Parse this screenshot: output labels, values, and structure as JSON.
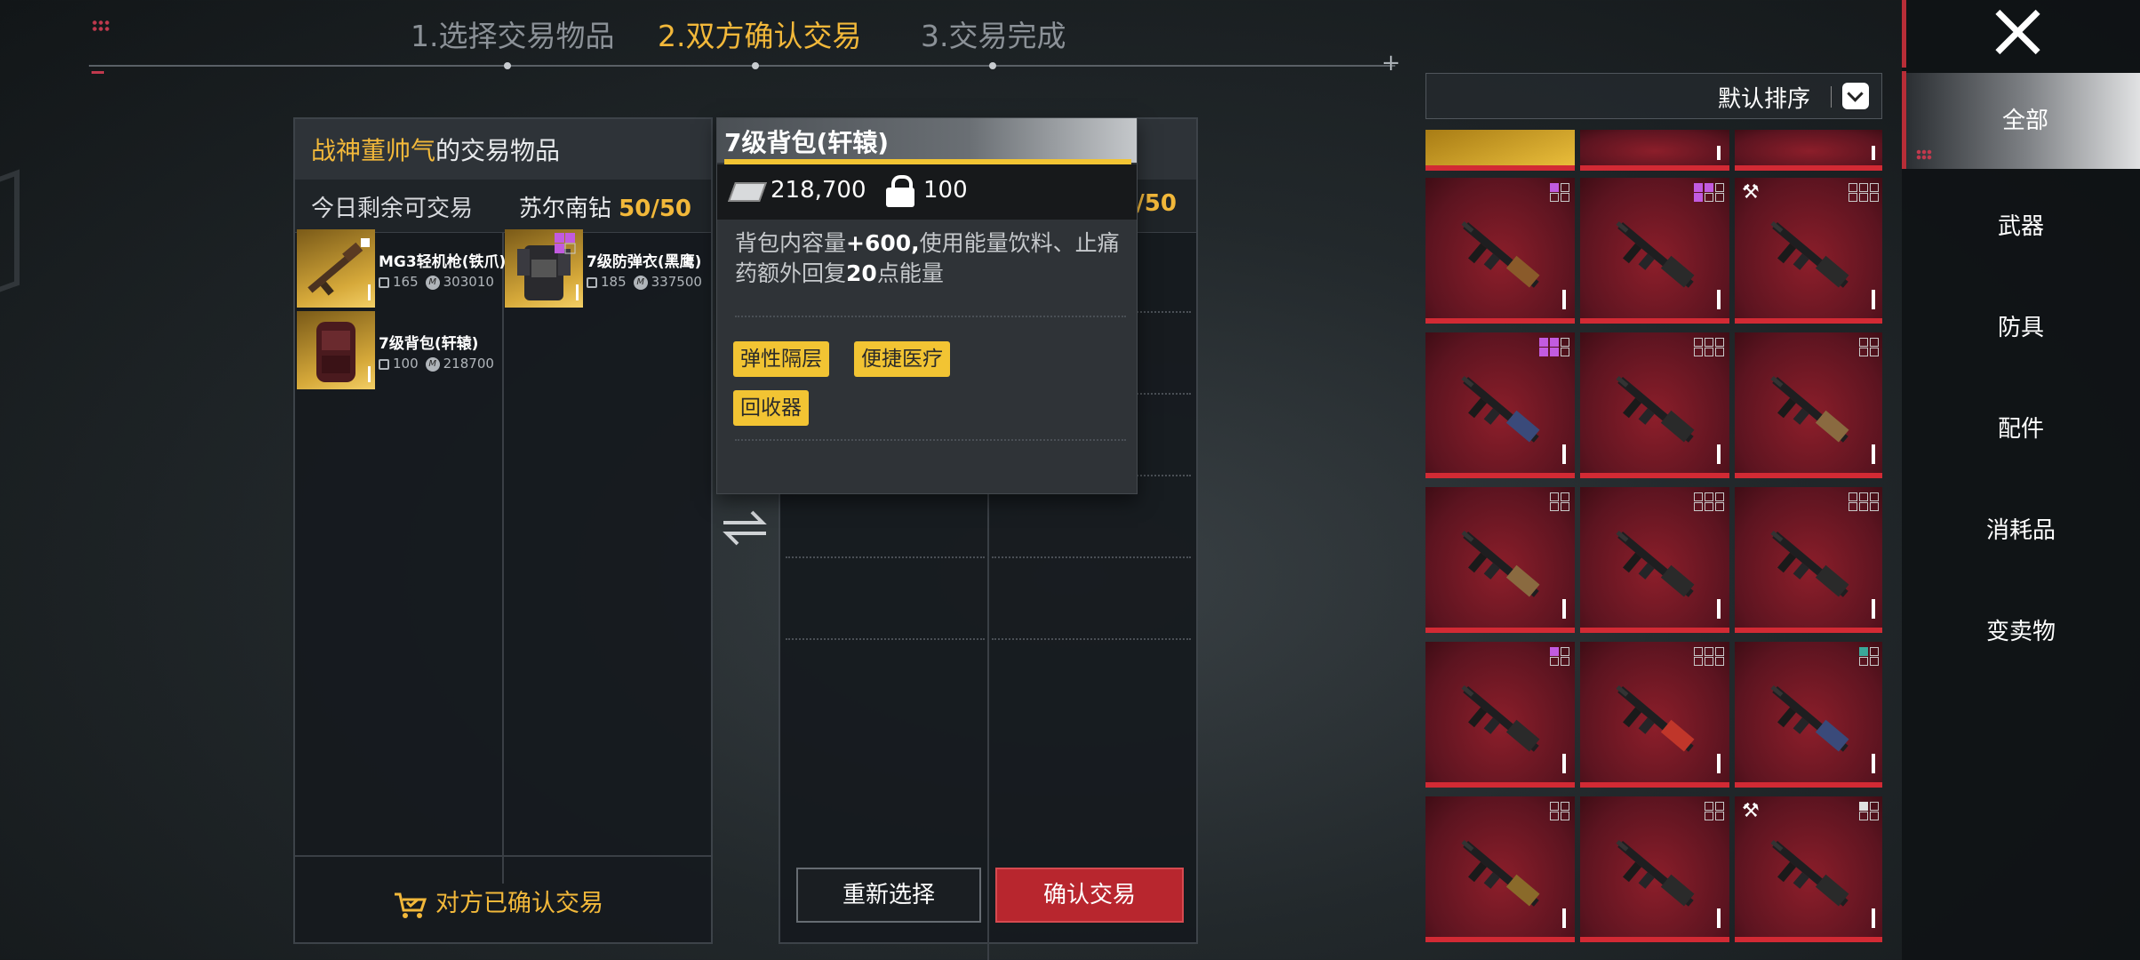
{
  "steps": [
    {
      "label": "1.选择交易物品",
      "active": false
    },
    {
      "label": "2.双方确认交易",
      "active": true
    },
    {
      "label": "3.交易完成",
      "active": false
    }
  ],
  "my_panel": {
    "owner": "战神董帅气",
    "title_suffix": "的交易物品",
    "remaining_label": "今日剩余可交易",
    "currency_label": "苏尔南钻",
    "currency_value": "50/50",
    "items": [
      {
        "name": "MG3轻机枪(铁爪)",
        "lock": "165",
        "price": "303010"
      },
      {
        "name": "7级防弹衣(黑鹰)",
        "lock": "185",
        "price": "337500"
      },
      {
        "name": "7级背包(轩辕)",
        "lock": "100",
        "price": "218700"
      }
    ],
    "status": "对方已确认交易"
  },
  "other_panel": {
    "currency_fragment": "0/50",
    "reselect_label": "重新选择",
    "confirm_label": "确认交易"
  },
  "tooltip": {
    "title": "7级背包(轩辕)",
    "price": "218,700",
    "lock": "100",
    "desc_prefix": "背包内容量",
    "desc_bold1": "+600,",
    "desc_mid": "使用能量饮料、止痛药额外回复",
    "desc_bold2": "20",
    "desc_suffix": "点能量",
    "tags": [
      "弹性隔层",
      "便捷医疗",
      "回收器"
    ]
  },
  "inventory": {
    "sort_label": "默认排序",
    "categories": [
      "全部",
      "武器",
      "防具",
      "配件",
      "消耗品",
      "变卖物"
    ],
    "active_category": "全部",
    "item_count": "1"
  },
  "colors": {
    "accent_gold": "#f2b83a",
    "confirm_red": "#b8262e",
    "item_red": "#8c1e2a"
  }
}
